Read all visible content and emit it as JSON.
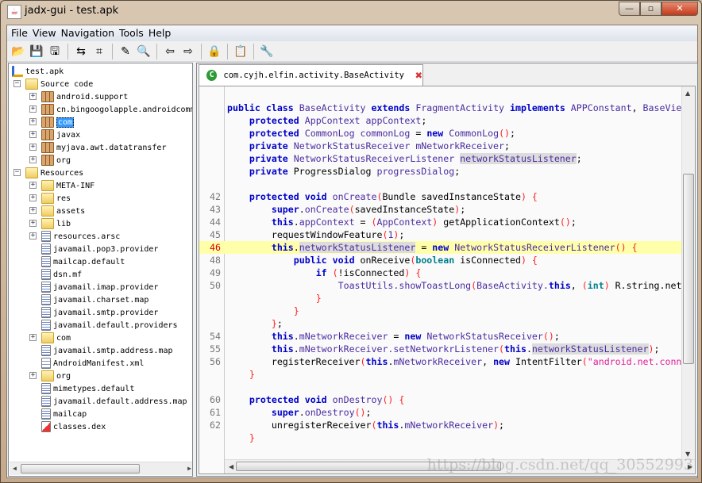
{
  "window": {
    "title": "jadx-gui - test.apk",
    "app_icon": "java-icon",
    "controls": {
      "minimize": "—",
      "maximize": "▫",
      "close": "✕"
    }
  },
  "menu": [
    {
      "label": "File"
    },
    {
      "label": "View"
    },
    {
      "label": "Navigation"
    },
    {
      "label": "Tools"
    },
    {
      "label": "Help"
    }
  ],
  "toolbar": [
    {
      "icon": "open-file-icon",
      "glyph": "📂"
    },
    {
      "icon": "save-all-icon",
      "glyph": "💾"
    },
    {
      "icon": "export-icon",
      "glyph": "🖫"
    },
    "sep",
    {
      "icon": "sync-icon",
      "glyph": "⇆"
    },
    {
      "icon": "flatten-packages-icon",
      "glyph": "⌗"
    },
    "sep",
    {
      "icon": "decompile-wand-icon",
      "glyph": "✎"
    },
    {
      "icon": "search-icon",
      "glyph": "🔍"
    },
    "sep",
    {
      "icon": "back-icon",
      "glyph": "⇦"
    },
    {
      "icon": "forward-icon",
      "glyph": "⇨"
    },
    "sep",
    {
      "icon": "deobfuscation-icon",
      "glyph": "🔒"
    },
    "sep",
    {
      "icon": "log-icon",
      "glyph": "📋"
    },
    "sep",
    {
      "icon": "preferences-wrench-icon",
      "glyph": "🔧"
    }
  ],
  "tree": [
    {
      "label": "test.apk",
      "level": 0,
      "icon": "apk",
      "exp": ""
    },
    {
      "label": "Source code",
      "level": 1,
      "icon": "fold",
      "exp": "-"
    },
    {
      "label": "android.support",
      "level": 2,
      "icon": "pkg",
      "exp": "+"
    },
    {
      "label": "cn.bingoogolapple.androidcommon",
      "level": 2,
      "icon": "pkg",
      "exp": "+"
    },
    {
      "label": "com",
      "level": 2,
      "icon": "pkg",
      "exp": "+",
      "selected": true
    },
    {
      "label": "javax",
      "level": 2,
      "icon": "pkg",
      "exp": "+"
    },
    {
      "label": "myjava.awt.datatransfer",
      "level": 2,
      "icon": "pkg",
      "exp": "+"
    },
    {
      "label": "org",
      "level": 2,
      "icon": "pkg",
      "exp": "+"
    },
    {
      "label": "Resources",
      "level": 1,
      "icon": "fold",
      "exp": "-"
    },
    {
      "label": "META-INF",
      "level": 2,
      "icon": "fold",
      "exp": "+"
    },
    {
      "label": "res",
      "level": 2,
      "icon": "fold",
      "exp": "+"
    },
    {
      "label": "assets",
      "level": 2,
      "icon": "fold",
      "exp": "+"
    },
    {
      "label": "lib",
      "level": 2,
      "icon": "fold",
      "exp": "+"
    },
    {
      "label": "resources.arsc",
      "level": 2,
      "icon": "file",
      "exp": "+"
    },
    {
      "label": "javamail.pop3.provider",
      "level": 2,
      "icon": "file",
      "exp": ""
    },
    {
      "label": "mailcap.default",
      "level": 2,
      "icon": "file",
      "exp": ""
    },
    {
      "label": "dsn.mf",
      "level": 2,
      "icon": "file",
      "exp": ""
    },
    {
      "label": "javamail.imap.provider",
      "level": 2,
      "icon": "file",
      "exp": ""
    },
    {
      "label": "javamail.charset.map",
      "level": 2,
      "icon": "file",
      "exp": ""
    },
    {
      "label": "javamail.smtp.provider",
      "level": 2,
      "icon": "file",
      "exp": ""
    },
    {
      "label": "javamail.default.providers",
      "level": 2,
      "icon": "file",
      "exp": ""
    },
    {
      "label": "com",
      "level": 2,
      "icon": "fold",
      "exp": "+"
    },
    {
      "label": "javamail.smtp.address.map",
      "level": 2,
      "icon": "file",
      "exp": ""
    },
    {
      "label": "AndroidManifest.xml",
      "level": 2,
      "icon": "xml",
      "exp": ""
    },
    {
      "label": "org",
      "level": 2,
      "icon": "fold",
      "exp": "+"
    },
    {
      "label": "mimetypes.default",
      "level": 2,
      "icon": "file",
      "exp": ""
    },
    {
      "label": "javamail.default.address.map",
      "level": 2,
      "icon": "file",
      "exp": ""
    },
    {
      "label": "mailcap",
      "level": 2,
      "icon": "file",
      "exp": ""
    },
    {
      "label": "classes.dex",
      "level": 2,
      "icon": "dex",
      "exp": ""
    }
  ],
  "tab": {
    "label": "com.cyjh.elfin.activity.BaseActivity",
    "icon": "class-icon",
    "icon_glyph": "C",
    "close_glyph": "✖"
  },
  "code": [
    {
      "n": "",
      "t": []
    },
    {
      "n": "",
      "t": [
        [
          "k",
          "public class "
        ],
        [
          "i",
          "BaseActivity "
        ],
        [
          "k",
          "extends "
        ],
        [
          "i",
          "FragmentActivity "
        ],
        [
          "k",
          "implements "
        ],
        [
          "i",
          "APPConstant"
        ],
        [
          "n",
          ", "
        ],
        [
          "i",
          "BaseVie"
        ]
      ]
    },
    {
      "n": "",
      "t": [
        [
          "n",
          "    "
        ],
        [
          "k",
          "protected "
        ],
        [
          "i",
          "AppContext appContext"
        ],
        [
          "n",
          ";"
        ]
      ]
    },
    {
      "n": "",
      "t": [
        [
          "n",
          "    "
        ],
        [
          "k",
          "protected "
        ],
        [
          "i",
          "CommonLog commonLog "
        ],
        [
          "n",
          "= "
        ],
        [
          "k",
          "new "
        ],
        [
          "i",
          "CommonLog"
        ],
        [
          "p",
          "()"
        ],
        [
          "n",
          ";"
        ]
      ]
    },
    {
      "n": "",
      "t": [
        [
          "n",
          "    "
        ],
        [
          "k",
          "private "
        ],
        [
          "i",
          "NetworkStatusReceiver mNetworkReceiver"
        ],
        [
          "n",
          ";"
        ]
      ]
    },
    {
      "n": "",
      "t": [
        [
          "n",
          "    "
        ],
        [
          "k",
          "private "
        ],
        [
          "i",
          "NetworkStatusReceiverListener "
        ],
        [
          "h",
          "networkStatusListener"
        ],
        [
          "n",
          ";"
        ]
      ]
    },
    {
      "n": "",
      "t": [
        [
          "n",
          "    "
        ],
        [
          "k",
          "private "
        ],
        [
          "n",
          "ProgressDialog "
        ],
        [
          "i",
          "progressDialog"
        ],
        [
          "n",
          ";"
        ]
      ]
    },
    {
      "n": "",
      "t": []
    },
    {
      "n": "42",
      "t": [
        [
          "n",
          "    "
        ],
        [
          "k",
          "protected void "
        ],
        [
          "i",
          "onCreate"
        ],
        [
          "p",
          "("
        ],
        [
          "n",
          "Bundle savedInstanceState"
        ],
        [
          "p",
          ") {"
        ]
      ]
    },
    {
      "n": "43",
      "t": [
        [
          "n",
          "        "
        ],
        [
          "k",
          "super"
        ],
        [
          "n",
          "."
        ],
        [
          "i",
          "onCreate"
        ],
        [
          "p",
          "("
        ],
        [
          "n",
          "savedInstanceState"
        ],
        [
          "p",
          ")"
        ],
        [
          "n",
          ";"
        ]
      ]
    },
    {
      "n": "44",
      "t": [
        [
          "n",
          "        "
        ],
        [
          "k",
          "this"
        ],
        [
          "n",
          "."
        ],
        [
          "i",
          "appContext "
        ],
        [
          "n",
          "= "
        ],
        [
          "p",
          "("
        ],
        [
          "i",
          "AppContext"
        ],
        [
          "p",
          ") "
        ],
        [
          "n",
          "getApplicationContext"
        ],
        [
          "p",
          "()"
        ],
        [
          "n",
          ";"
        ]
      ]
    },
    {
      "n": "45",
      "t": [
        [
          "n",
          "        requestWindowFeature"
        ],
        [
          "p",
          "("
        ],
        [
          "i",
          "1"
        ],
        [
          "p",
          ")"
        ],
        [
          "n",
          ";"
        ]
      ]
    },
    {
      "n": "46",
      "cur": true,
      "t": [
        [
          "n",
          "        "
        ],
        [
          "k",
          "this"
        ],
        [
          "n",
          "."
        ],
        [
          "h",
          "networkStatusListener"
        ],
        [
          "n",
          " = "
        ],
        [
          "k",
          "new "
        ],
        [
          "i",
          "NetworkStatusReceiverListener"
        ],
        [
          "p",
          "() {"
        ]
      ]
    },
    {
      "n": "48",
      "t": [
        [
          "n",
          "            "
        ],
        [
          "k",
          "public void "
        ],
        [
          "n",
          "onReceive"
        ],
        [
          "p",
          "("
        ],
        [
          "b",
          "boolean "
        ],
        [
          "n",
          "isConnected"
        ],
        [
          "p",
          ") {"
        ]
      ]
    },
    {
      "n": "49",
      "t": [
        [
          "n",
          "                "
        ],
        [
          "k",
          "if "
        ],
        [
          "p",
          "("
        ],
        [
          "n",
          "!isConnected"
        ],
        [
          "p",
          ") {"
        ]
      ]
    },
    {
      "n": "50",
      "t": [
        [
          "n",
          "                    "
        ],
        [
          "i",
          "ToastUtils.showToastLong"
        ],
        [
          "p",
          "("
        ],
        [
          "i",
          "BaseActivity."
        ],
        [
          "k",
          "this"
        ],
        [
          "n",
          ", "
        ],
        [
          "p",
          "("
        ],
        [
          "b",
          "int"
        ],
        [
          "p",
          ") "
        ],
        [
          "n",
          "R.string.net"
        ]
      ]
    },
    {
      "n": "",
      "t": [
        [
          "n",
          "                "
        ],
        [
          "p",
          "}"
        ]
      ]
    },
    {
      "n": "",
      "t": [
        [
          "n",
          "            "
        ],
        [
          "p",
          "}"
        ]
      ]
    },
    {
      "n": "",
      "t": [
        [
          "n",
          "        "
        ],
        [
          "p",
          "}"
        ],
        [
          "n",
          ";"
        ]
      ]
    },
    {
      "n": "54",
      "t": [
        [
          "n",
          "        "
        ],
        [
          "k",
          "this"
        ],
        [
          "n",
          "."
        ],
        [
          "i",
          "mNetworkReceiver "
        ],
        [
          "n",
          "= "
        ],
        [
          "k",
          "new "
        ],
        [
          "i",
          "NetworkStatusReceiver"
        ],
        [
          "p",
          "()"
        ],
        [
          "n",
          ";"
        ]
      ]
    },
    {
      "n": "55",
      "t": [
        [
          "n",
          "        "
        ],
        [
          "k",
          "this"
        ],
        [
          "n",
          "."
        ],
        [
          "i",
          "mNetworkReceiver.setNetworkrListener"
        ],
        [
          "p",
          "("
        ],
        [
          "k",
          "this"
        ],
        [
          "n",
          "."
        ],
        [
          "h",
          "networkStatusListener"
        ],
        [
          "p",
          ")"
        ],
        [
          "n",
          ";"
        ]
      ]
    },
    {
      "n": "56",
      "t": [
        [
          "n",
          "        registerReceiver"
        ],
        [
          "p",
          "("
        ],
        [
          "k",
          "this"
        ],
        [
          "n",
          "."
        ],
        [
          "i",
          "mNetworkReceiver"
        ],
        [
          "n",
          ", "
        ],
        [
          "k",
          "new "
        ],
        [
          "n",
          "IntentFilter"
        ],
        [
          "p",
          "("
        ],
        [
          "s",
          "\"android.net.conn"
        ]
      ]
    },
    {
      "n": "",
      "t": [
        [
          "n",
          "    "
        ],
        [
          "p",
          "}"
        ]
      ]
    },
    {
      "n": "",
      "t": []
    },
    {
      "n": "60",
      "t": [
        [
          "n",
          "    "
        ],
        [
          "k",
          "protected void "
        ],
        [
          "i",
          "onDestroy"
        ],
        [
          "p",
          "() {"
        ]
      ]
    },
    {
      "n": "61",
      "t": [
        [
          "n",
          "        "
        ],
        [
          "k",
          "super"
        ],
        [
          "n",
          "."
        ],
        [
          "i",
          "onDestroy"
        ],
        [
          "p",
          "()"
        ],
        [
          "n",
          ";"
        ]
      ]
    },
    {
      "n": "62",
      "t": [
        [
          "n",
          "        unregisterReceiver"
        ],
        [
          "p",
          "("
        ],
        [
          "k",
          "this"
        ],
        [
          "n",
          "."
        ],
        [
          "i",
          "mNetworkReceiver"
        ],
        [
          "p",
          ")"
        ],
        [
          "n",
          ";"
        ]
      ]
    },
    {
      "n": "",
      "t": [
        [
          "n",
          "    "
        ],
        [
          "p",
          "}"
        ]
      ]
    }
  ],
  "watermark": "https://blog.csdn.net/qq_30552993"
}
